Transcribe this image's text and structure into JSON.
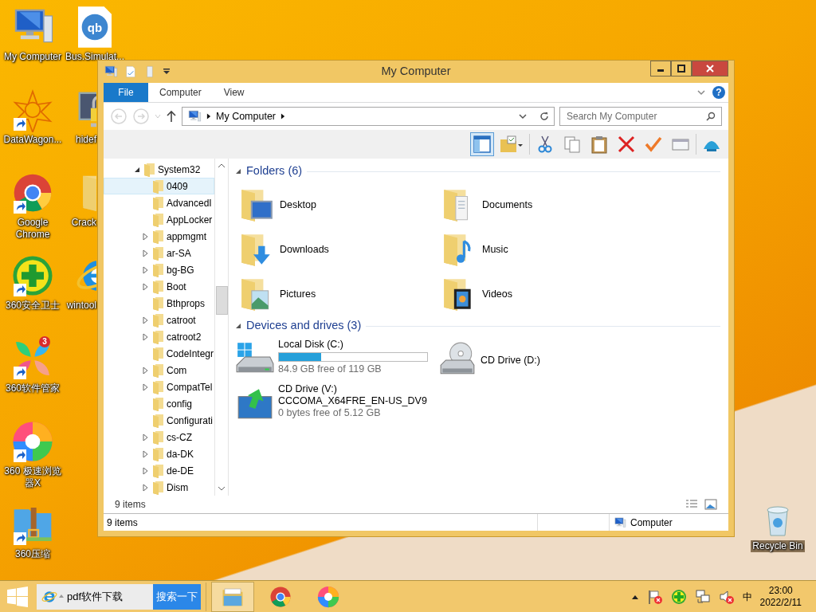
{
  "desktop_columns": [
    [
      {
        "label": "My Computer",
        "kind": "computer",
        "shortcut": false
      },
      {
        "label": "DataWagon...",
        "kind": "datawagon",
        "shortcut": true
      },
      {
        "label": "Google Chrome",
        "kind": "chrome",
        "shortcut": true
      },
      {
        "label": "360安全卫士",
        "kind": "guard360",
        "shortcut": true
      },
      {
        "label": "360软件管家",
        "kind": "softmgr",
        "shortcut": true,
        "badge": "3"
      },
      {
        "label": "360 极速浏览器X",
        "kind": "browser360",
        "shortcut": true
      },
      {
        "label": "360压缩",
        "kind": "zip360",
        "shortcut": true
      }
    ],
    [
      {
        "label": "Bus.Simulat...",
        "kind": "qbittorrent",
        "shortcut": false,
        "logo_text": "qb"
      },
      {
        "label": "hidef",
        "kind": "lockscreen",
        "shortcut": false
      },
      {
        "label": "Crack",
        "kind": "folder",
        "shortcut": false
      },
      {
        "label": "wintool",
        "kind": "ie",
        "shortcut": false
      }
    ]
  ],
  "recycle_bin": {
    "label": "Recycle Bin"
  },
  "window": {
    "title": "My Computer",
    "ribbon_tabs": [
      {
        "label": "File",
        "selected": true
      },
      {
        "label": "Computer",
        "selected": false
      },
      {
        "label": "View",
        "selected": false
      }
    ],
    "help_label": "?",
    "address": {
      "path": [
        "My Computer"
      ]
    },
    "search": {
      "placeholder": "Search My Computer"
    },
    "toolbar": [
      {
        "kind": "pane",
        "selected": true
      },
      {
        "kind": "foldercheck",
        "selected": false
      },
      {
        "kind": "cut",
        "selected": false
      },
      {
        "kind": "copy",
        "selected": false
      },
      {
        "kind": "paste",
        "selected": false
      },
      {
        "kind": "delete",
        "selected": false
      },
      {
        "kind": "check",
        "selected": false
      },
      {
        "kind": "card",
        "selected": false
      },
      {
        "kind": "shell",
        "selected": false
      }
    ],
    "tree": {
      "items": [
        {
          "label": "System32",
          "expanded": true,
          "selected": false,
          "children": [
            {
              "label": "0409",
              "has_children": false,
              "selected": true
            },
            {
              "label": "AdvancedI",
              "has_children": false,
              "selected": false
            },
            {
              "label": "AppLocker",
              "has_children": false,
              "selected": false
            },
            {
              "label": "appmgmt",
              "has_children": true,
              "selected": false
            },
            {
              "label": "ar-SA",
              "has_children": true,
              "selected": false
            },
            {
              "label": "bg-BG",
              "has_children": true,
              "selected": false
            },
            {
              "label": "Boot",
              "has_children": true,
              "selected": false
            },
            {
              "label": "Bthprops",
              "has_children": false,
              "selected": false
            },
            {
              "label": "catroot",
              "has_children": true,
              "selected": false
            },
            {
              "label": "catroot2",
              "has_children": true,
              "selected": false
            },
            {
              "label": "CodeIntegr",
              "has_children": false,
              "selected": false
            },
            {
              "label": "Com",
              "has_children": true,
              "selected": false
            },
            {
              "label": "CompatTel",
              "has_children": true,
              "selected": false
            },
            {
              "label": "config",
              "has_children": false,
              "selected": false
            },
            {
              "label": "Configurati",
              "has_children": false,
              "selected": false
            },
            {
              "label": "cs-CZ",
              "has_children": true,
              "selected": false
            },
            {
              "label": "da-DK",
              "has_children": true,
              "selected": false
            },
            {
              "label": "de-DE",
              "has_children": true,
              "selected": false
            },
            {
              "label": "Dism",
              "has_children": true,
              "selected": false
            }
          ]
        }
      ]
    },
    "sections": [
      {
        "title": "Folders (6)",
        "expanded": true,
        "items": [
          {
            "label": "Desktop",
            "kind": "desktop"
          },
          {
            "label": "Documents",
            "kind": "documents"
          },
          {
            "label": "Downloads",
            "kind": "downloads"
          },
          {
            "label": "Music",
            "kind": "music"
          },
          {
            "label": "Pictures",
            "kind": "pictures"
          },
          {
            "label": "Videos",
            "kind": "videos"
          }
        ]
      },
      {
        "title": "Devices and drives (3)",
        "expanded": true,
        "items": [
          {
            "label": "Local Disk (C:)",
            "kind": "hdd",
            "level": 0.287,
            "detail": "84.9 GB free of 119 GB"
          },
          {
            "label": "CD Drive (D:)",
            "kind": "cd"
          },
          {
            "label": "CD Drive (V:)",
            "kind": "setup",
            "sublabel": "CCCOMA_X64FRE_EN-US_DV9",
            "detail": "0 bytes free of 5.12 GB"
          }
        ]
      }
    ],
    "item_count": "9 items",
    "status_bar": {
      "left": "9 items",
      "location": "Computer"
    }
  },
  "taskbar": {
    "search_value": "pdf软件下载",
    "search_button": "搜索一下",
    "apps": [
      {
        "kind": "explorer",
        "active": true
      },
      {
        "kind": "chrome",
        "active": false
      },
      {
        "kind": "browser360",
        "active": false
      }
    ],
    "tray": {
      "ime": "中",
      "time": "23:00",
      "date": "2022/2/11"
    }
  }
}
